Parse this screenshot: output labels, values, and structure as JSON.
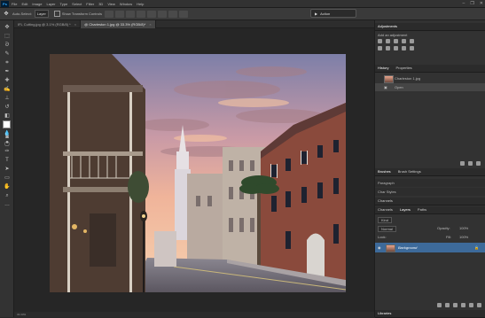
{
  "app": {
    "logo": "Ps"
  },
  "menu": [
    "File",
    "Edit",
    "Image",
    "Layer",
    "Type",
    "Select",
    "Filter",
    "3D",
    "View",
    "Window",
    "Help"
  ],
  "window_controls": [
    "–",
    "❐",
    "✕"
  ],
  "options_bar": {
    "tool_icon": "move-tool",
    "auto_select_label": "Auto-Select:",
    "auto_select_value": "Layer",
    "transform_controls_label": "Show Transform Controls"
  },
  "action_pill": {
    "play": "▶",
    "label": "Action"
  },
  "tabs": [
    {
      "label": "IFL Cutting.jpg @ 3.1% (RGB/8) *",
      "active": false
    },
    {
      "label": "@ Charleston 1.jpg @ 33.3% (RGB/8)*",
      "active": true
    }
  ],
  "status_bar": {
    "zoom": "33.33%"
  },
  "panels": {
    "adjustments": {
      "title": "Adjustments",
      "subtitle": "Add an adjustment"
    },
    "history": {
      "tabs": [
        "History",
        "Properties"
      ],
      "items": [
        "Charleston 1.jpg",
        "Open"
      ]
    },
    "brushes": {
      "tabs": [
        "Brushes",
        "Brush Settings"
      ],
      "items": [
        "Paragraph",
        "Char Styles"
      ]
    },
    "layers": {
      "section": "Channels",
      "tabs": [
        "Channels",
        "Layers",
        "Paths"
      ],
      "kind_label": "Kind",
      "blend_mode": "Normal",
      "opacity_label": "Opacity:",
      "opacity": "100%",
      "lock_label": "Lock:",
      "fill_label": "Fill:",
      "fill": "100%",
      "layer_name": "Background"
    },
    "bottom_tab": "Libraries"
  },
  "colors": {
    "accent": "#31a8ff",
    "selected_layer": "#3d6a9a",
    "foreground": "#ffffff",
    "background": "#000000"
  }
}
